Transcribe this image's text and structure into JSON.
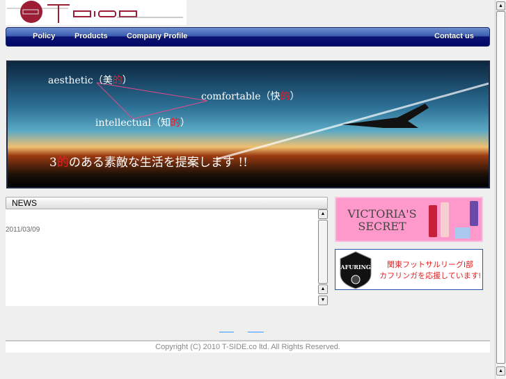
{
  "logo": {
    "text": "TSIDE"
  },
  "nav": {
    "items": [
      {
        "label": "Policy"
      },
      {
        "label": "Products"
      },
      {
        "label": "Company Profile"
      },
      {
        "label": "Contact us"
      }
    ]
  },
  "hero": {
    "aesthetic": "aesthetic（美",
    "aesthetic_r": "的",
    "aesthetic_e": "）",
    "comfortable": "comfortable（快",
    "comfortable_r": "的",
    "comfortable_e": "）",
    "intellectual": "intellectual（知",
    "intellectual_r": "的",
    "intellectual_e": "）",
    "tag_a": "3",
    "tag_r": "的",
    "tag_b": "のある素敵な生活を提案します !!"
  },
  "news": {
    "title": "NEWS",
    "items": [
      {
        "date": "2011/03/09"
      }
    ]
  },
  "banners": {
    "victoria": "VICTORIA'S SECRET",
    "cafuringa_line1": "関東フットサルリーグI部",
    "cafuringa_line2": "カフリンガを応援しています!",
    "cafuringa_logo": "CAFURINGA"
  },
  "footer": {
    "copyright": "Copyright (C) 2010 T-SIDE.co ltd. All Rights Reserved."
  },
  "colors": {
    "nav": "#000a66",
    "accent": "#e0202a",
    "pink": "#ff99cc"
  }
}
